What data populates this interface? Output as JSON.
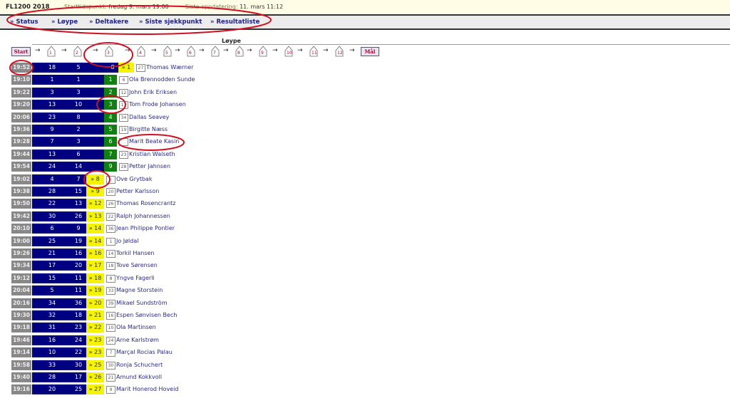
{
  "header": {
    "title": "FL1200 2018",
    "start_label": "Starttidspunkt:",
    "start_value": "fredag 9. mars 19:00",
    "update_label": "Siste oppdatering:",
    "update_value": "11. mars 11:12"
  },
  "nav": [
    "» Status",
    "» Løype",
    "» Deltakere",
    "» Siste sjekkpunkt",
    "» Resultatliste"
  ],
  "course": {
    "title": "Løype",
    "start": "Start",
    "finish": "Mål",
    "checkpoints": [
      "1",
      "2",
      "3",
      "4",
      "5",
      "6",
      "7",
      "8",
      "9",
      "10",
      "11",
      "12"
    ]
  },
  "colors": {
    "navy": "#000080",
    "green": "#108010",
    "yellow": "#f4f400",
    "time": "#888888"
  },
  "rows": [
    {
      "time": "19:52",
      "a": "18",
      "b": "5",
      "mid": "8",
      "status": "» 1",
      "type": "yellow",
      "bib": "27",
      "name": "Thomas Wærner",
      "progress": 0.95
    },
    {
      "time": "19:10",
      "a": "1",
      "b": "1",
      "status": "1",
      "type": "green",
      "bib": "6",
      "name": "Ola Brennodden Sunde"
    },
    {
      "time": "19:22",
      "a": "3",
      "b": "3",
      "status": "2",
      "type": "green",
      "bib": "12",
      "name": "John Erik Eriksen"
    },
    {
      "time": "19:20",
      "a": "13",
      "b": "10",
      "status": "3",
      "type": "green",
      "bib": "11",
      "name": "Tom Frode Johansen"
    },
    {
      "time": "20:06",
      "a": "23",
      "b": "8",
      "status": "4",
      "type": "green",
      "bib": "34",
      "name": "Dallas Seavey"
    },
    {
      "time": "19:36",
      "a": "9",
      "b": "2",
      "status": "5",
      "type": "green",
      "bib": "19",
      "name": "Birgitte Næss"
    },
    {
      "time": "19:28",
      "a": "7",
      "b": "3",
      "status": "6",
      "type": "green",
      "bib": "",
      "name": "Marit Beate Kasin"
    },
    {
      "time": "19:44",
      "a": "13",
      "b": "6",
      "status": "7",
      "type": "green",
      "bib": "23",
      "name": "Kristian Walseth"
    },
    {
      "time": "19:54",
      "a": "24",
      "b": "14",
      "status": "9",
      "type": "green",
      "bib": "28",
      "name": "Petter Jahnsen"
    },
    {
      "time": "19:02",
      "a": "4",
      "b": "7",
      "status": "» 8",
      "type": "yellow",
      "bib": "",
      "name": "Ove Grytbak"
    },
    {
      "time": "19:38",
      "a": "28",
      "b": "15",
      "status": "» 9",
      "type": "yellow",
      "bib": "20",
      "name": "Petter Karlsson"
    },
    {
      "time": "19:50",
      "a": "22",
      "b": "13",
      "status": "» 12",
      "type": "yellow",
      "bib": "26",
      "name": "Thomas Rosencrantz"
    },
    {
      "time": "19:42",
      "a": "30",
      "b": "26",
      "status": "» 13",
      "type": "yellow",
      "bib": "22",
      "name": "Ralph Johannessen"
    },
    {
      "time": "20:10",
      "a": "6",
      "b": "9",
      "status": "» 14",
      "type": "yellow",
      "bib": "36",
      "name": "Jean Philippe Pontier"
    },
    {
      "time": "19:00",
      "a": "25",
      "b": "19",
      "status": "» 14",
      "type": "yellow",
      "bib": "1",
      "name": "Jo Jøldal"
    },
    {
      "time": "19:26",
      "a": "21",
      "b": "16",
      "status": "» 16",
      "type": "yellow",
      "bib": "14",
      "name": "Torkil Hansen"
    },
    {
      "time": "19:34",
      "a": "17",
      "b": "20",
      "status": "» 17",
      "type": "yellow",
      "bib": "18",
      "name": "Tove Sørensen"
    },
    {
      "time": "19:12",
      "a": "15",
      "b": "11",
      "status": "» 18",
      "type": "yellow",
      "bib": "8",
      "name": "Yngve Fagerli"
    },
    {
      "time": "20:04",
      "a": "5",
      "b": "11",
      "status": "» 19",
      "type": "yellow",
      "bib": "33",
      "name": "Magne Storstein"
    },
    {
      "time": "20:16",
      "a": "34",
      "b": "36",
      "status": "» 20",
      "type": "yellow",
      "bib": "39",
      "name": "Mikael Sundström"
    },
    {
      "time": "19:30",
      "a": "32",
      "b": "18",
      "status": "» 21",
      "type": "yellow",
      "bib": "16",
      "name": "Espen Sønvisen Bech"
    },
    {
      "time": "19:18",
      "a": "31",
      "b": "23",
      "status": "» 22",
      "type": "yellow",
      "bib": "10",
      "name": "Ola Martinsen"
    },
    {
      "time": "19:46",
      "a": "16",
      "b": "24",
      "status": "» 23",
      "type": "yellow",
      "bib": "24",
      "name": "Arne Karlstrøm"
    },
    {
      "time": "19:14",
      "a": "10",
      "b": "22",
      "status": "» 23",
      "type": "yellow",
      "bib": "7",
      "name": "Marçal Rocias Palau"
    },
    {
      "time": "19:58",
      "a": "33",
      "b": "30",
      "status": "» 25",
      "type": "yellow",
      "bib": "30",
      "name": "Ronja Schuchert"
    },
    {
      "time": "19:40",
      "a": "28",
      "b": "17",
      "status": "» 26",
      "type": "yellow",
      "bib": "21",
      "name": "Amund Kokkvoll"
    },
    {
      "time": "19:16",
      "a": "20",
      "b": "25",
      "status": "» 27",
      "type": "yellow",
      "bib": "9",
      "name": "Marit Honerod Hoveid"
    }
  ]
}
